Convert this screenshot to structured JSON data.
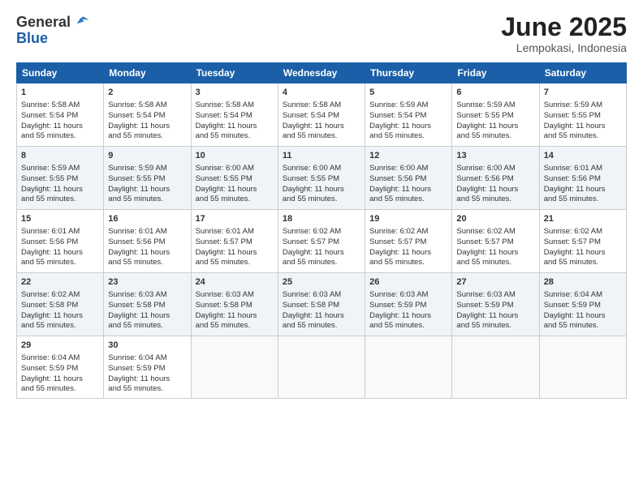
{
  "header": {
    "logo_general": "General",
    "logo_blue": "Blue",
    "month_title": "June 2025",
    "location": "Lempokasi, Indonesia"
  },
  "weekdays": [
    "Sunday",
    "Monday",
    "Tuesday",
    "Wednesday",
    "Thursday",
    "Friday",
    "Saturday"
  ],
  "weeks": [
    [
      {
        "day": "1",
        "sunrise": "5:58 AM",
        "sunset": "5:54 PM",
        "daylight": "11 hours and 55 minutes."
      },
      {
        "day": "2",
        "sunrise": "5:58 AM",
        "sunset": "5:54 PM",
        "daylight": "11 hours and 55 minutes."
      },
      {
        "day": "3",
        "sunrise": "5:58 AM",
        "sunset": "5:54 PM",
        "daylight": "11 hours and 55 minutes."
      },
      {
        "day": "4",
        "sunrise": "5:58 AM",
        "sunset": "5:54 PM",
        "daylight": "11 hours and 55 minutes."
      },
      {
        "day": "5",
        "sunrise": "5:59 AM",
        "sunset": "5:54 PM",
        "daylight": "11 hours and 55 minutes."
      },
      {
        "day": "6",
        "sunrise": "5:59 AM",
        "sunset": "5:55 PM",
        "daylight": "11 hours and 55 minutes."
      },
      {
        "day": "7",
        "sunrise": "5:59 AM",
        "sunset": "5:55 PM",
        "daylight": "11 hours and 55 minutes."
      }
    ],
    [
      {
        "day": "8",
        "sunrise": "5:59 AM",
        "sunset": "5:55 PM",
        "daylight": "11 hours and 55 minutes."
      },
      {
        "day": "9",
        "sunrise": "5:59 AM",
        "sunset": "5:55 PM",
        "daylight": "11 hours and 55 minutes."
      },
      {
        "day": "10",
        "sunrise": "6:00 AM",
        "sunset": "5:55 PM",
        "daylight": "11 hours and 55 minutes."
      },
      {
        "day": "11",
        "sunrise": "6:00 AM",
        "sunset": "5:55 PM",
        "daylight": "11 hours and 55 minutes."
      },
      {
        "day": "12",
        "sunrise": "6:00 AM",
        "sunset": "5:56 PM",
        "daylight": "11 hours and 55 minutes."
      },
      {
        "day": "13",
        "sunrise": "6:00 AM",
        "sunset": "5:56 PM",
        "daylight": "11 hours and 55 minutes."
      },
      {
        "day": "14",
        "sunrise": "6:01 AM",
        "sunset": "5:56 PM",
        "daylight": "11 hours and 55 minutes."
      }
    ],
    [
      {
        "day": "15",
        "sunrise": "6:01 AM",
        "sunset": "5:56 PM",
        "daylight": "11 hours and 55 minutes."
      },
      {
        "day": "16",
        "sunrise": "6:01 AM",
        "sunset": "5:56 PM",
        "daylight": "11 hours and 55 minutes."
      },
      {
        "day": "17",
        "sunrise": "6:01 AM",
        "sunset": "5:57 PM",
        "daylight": "11 hours and 55 minutes."
      },
      {
        "day": "18",
        "sunrise": "6:02 AM",
        "sunset": "5:57 PM",
        "daylight": "11 hours and 55 minutes."
      },
      {
        "day": "19",
        "sunrise": "6:02 AM",
        "sunset": "5:57 PM",
        "daylight": "11 hours and 55 minutes."
      },
      {
        "day": "20",
        "sunrise": "6:02 AM",
        "sunset": "5:57 PM",
        "daylight": "11 hours and 55 minutes."
      },
      {
        "day": "21",
        "sunrise": "6:02 AM",
        "sunset": "5:57 PM",
        "daylight": "11 hours and 55 minutes."
      }
    ],
    [
      {
        "day": "22",
        "sunrise": "6:02 AM",
        "sunset": "5:58 PM",
        "daylight": "11 hours and 55 minutes."
      },
      {
        "day": "23",
        "sunrise": "6:03 AM",
        "sunset": "5:58 PM",
        "daylight": "11 hours and 55 minutes."
      },
      {
        "day": "24",
        "sunrise": "6:03 AM",
        "sunset": "5:58 PM",
        "daylight": "11 hours and 55 minutes."
      },
      {
        "day": "25",
        "sunrise": "6:03 AM",
        "sunset": "5:58 PM",
        "daylight": "11 hours and 55 minutes."
      },
      {
        "day": "26",
        "sunrise": "6:03 AM",
        "sunset": "5:59 PM",
        "daylight": "11 hours and 55 minutes."
      },
      {
        "day": "27",
        "sunrise": "6:03 AM",
        "sunset": "5:59 PM",
        "daylight": "11 hours and 55 minutes."
      },
      {
        "day": "28",
        "sunrise": "6:04 AM",
        "sunset": "5:59 PM",
        "daylight": "11 hours and 55 minutes."
      }
    ],
    [
      {
        "day": "29",
        "sunrise": "6:04 AM",
        "sunset": "5:59 PM",
        "daylight": "11 hours and 55 minutes."
      },
      {
        "day": "30",
        "sunrise": "6:04 AM",
        "sunset": "5:59 PM",
        "daylight": "11 hours and 55 minutes."
      },
      null,
      null,
      null,
      null,
      null
    ]
  ],
  "labels": {
    "sunrise": "Sunrise:",
    "sunset": "Sunset:",
    "daylight": "Daylight:"
  }
}
